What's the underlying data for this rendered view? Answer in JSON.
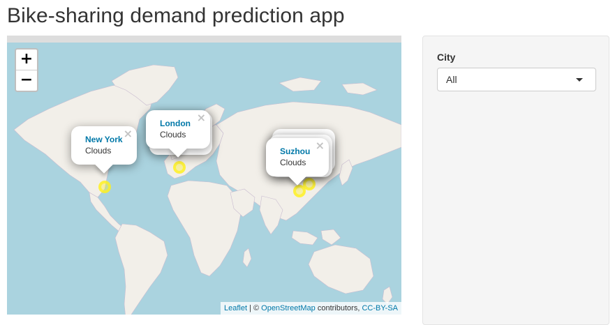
{
  "app": {
    "title": "Bike-sharing demand prediction app"
  },
  "map": {
    "zoom_in_label": "+",
    "zoom_out_label": "−",
    "popups": [
      {
        "city": "New York",
        "weather": "Clouds",
        "close": "×"
      },
      {
        "city": "London",
        "weather": "Clouds",
        "close": "×"
      },
      {
        "city": "Suzhou",
        "weather": "Clouds",
        "close": "×"
      }
    ],
    "attribution": {
      "leaflet": "Leaflet",
      "separator": " | © ",
      "osm": "OpenStreetMap",
      "contributors": " contributors, ",
      "license": "CC-BY-SA"
    },
    "colors": {
      "water": "#aad3df",
      "land": "#f2efe9",
      "marker": "#fff01e",
      "link": "#0078a8"
    }
  },
  "sidebar": {
    "city_label": "City",
    "city_select": {
      "selected": "All"
    }
  }
}
